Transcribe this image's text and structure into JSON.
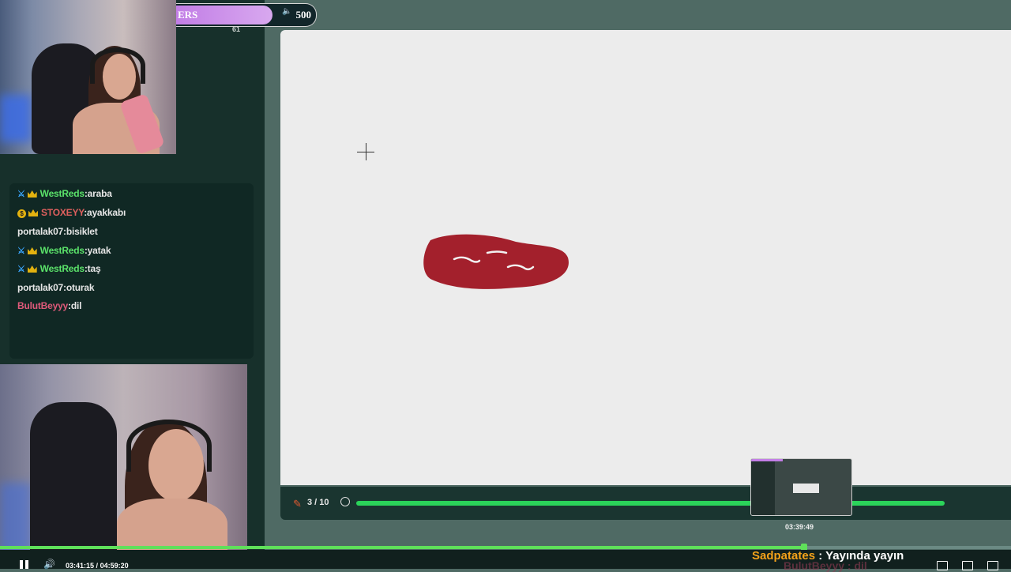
{
  "top_bar": {
    "label": "ERS",
    "value": "500",
    "progress_percent": 68,
    "small_count": "61"
  },
  "chat": {
    "messages": [
      {
        "user": "WestReds",
        "sep": ":",
        "text": "araba",
        "badges": [
          "sword-icon",
          "crown-icon"
        ],
        "user_color": "#5be36a"
      },
      {
        "user": "STOXEYY",
        "sep": ":",
        "text": "ayakkabı",
        "badges": [
          "coin-icon",
          "crown-icon"
        ],
        "user_color": "#e0605e"
      },
      {
        "user": "portalak07",
        "sep": ":",
        "text": "bisiklet",
        "badges": [],
        "user_color": "#e6e6e6"
      },
      {
        "user": "WestReds",
        "sep": ":",
        "text": "yatak",
        "badges": [
          "sword-icon",
          "crown-icon"
        ],
        "user_color": "#5be36a"
      },
      {
        "user": "WestReds",
        "sep": ":",
        "text": "taş",
        "badges": [
          "sword-icon",
          "crown-icon"
        ],
        "user_color": "#5be36a"
      },
      {
        "user": "portalak07",
        "sep": ":",
        "text": "oturak",
        "badges": [],
        "user_color": "#e6e6e6"
      },
      {
        "user": "BulutBeyyy",
        "sep": ":",
        "text": "dil",
        "badges": [],
        "user_color": "#e05a7a"
      }
    ]
  },
  "game": {
    "round": "3 / 10",
    "timer_percent": 100,
    "accent": "#2bd45a"
  },
  "preview": {
    "time": "03:39:49"
  },
  "player": {
    "current_time": "03:41:15",
    "separator": "/",
    "duration": "04:59:20",
    "progress_percent": 79.5
  },
  "caption": {
    "user": "Sadpatates",
    "sep": " : ",
    "text": "Yayında yayın",
    "ghost": "BulutBeyyy : dil"
  },
  "colors": {
    "drawing": "#a3202c",
    "canvas": "#ececec",
    "panel": "#17302b"
  }
}
